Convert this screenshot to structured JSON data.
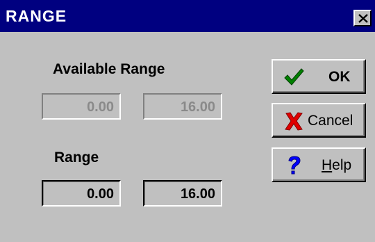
{
  "window": {
    "title": "RANGE"
  },
  "available_range": {
    "label": "Available Range",
    "min": "0.00",
    "max": "16.00"
  },
  "range": {
    "label": "Range",
    "min": "0.00",
    "max": "16.00"
  },
  "buttons": {
    "ok_label": "OK",
    "cancel_label": "Cancel",
    "help_label_underlined": "H",
    "help_label_rest": "elp"
  },
  "icons": {
    "close": "close-icon",
    "ok": "checkmark-icon",
    "cancel": "x-mark-icon",
    "help": "question-mark-icon"
  },
  "colors": {
    "titlebar": "#000080",
    "face": "#c0c0c0",
    "check_green": "#008000",
    "cancel_red": "#e00000",
    "help_blue": "#0000ff"
  }
}
